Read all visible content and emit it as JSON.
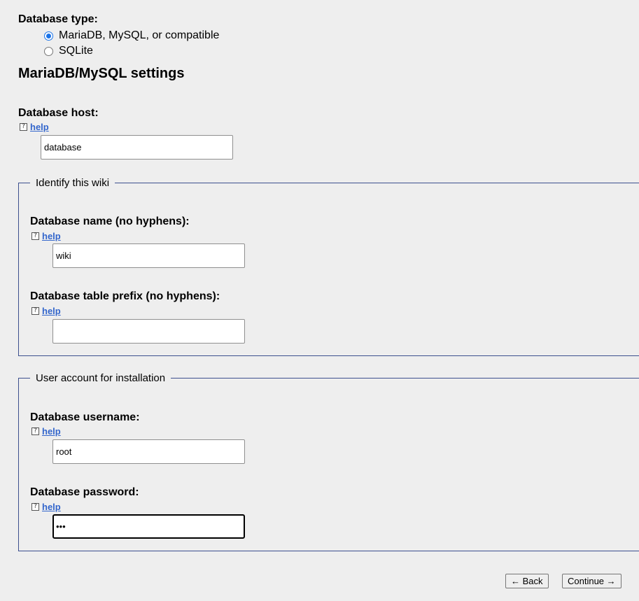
{
  "db_type": {
    "label": "Database type:",
    "options": [
      {
        "label": "MariaDB, MySQL, or compatible",
        "checked": true
      },
      {
        "label": "SQLite",
        "checked": false
      }
    ]
  },
  "settings_title": "MariaDB/MySQL settings",
  "help_label": "help",
  "help_icon_glyph": "?",
  "host": {
    "label": "Database host:",
    "value": "database"
  },
  "identify": {
    "legend": "Identify this wiki",
    "name": {
      "label": "Database name (no hyphens):",
      "value": "wiki"
    },
    "prefix": {
      "label": "Database table prefix (no hyphens):",
      "value": ""
    }
  },
  "account": {
    "legend": "User account for installation",
    "username": {
      "label": "Database username:",
      "value": "root"
    },
    "password": {
      "label": "Database password:",
      "value": "•••"
    }
  },
  "buttons": {
    "back": "← Back",
    "continue": "Continue →"
  }
}
